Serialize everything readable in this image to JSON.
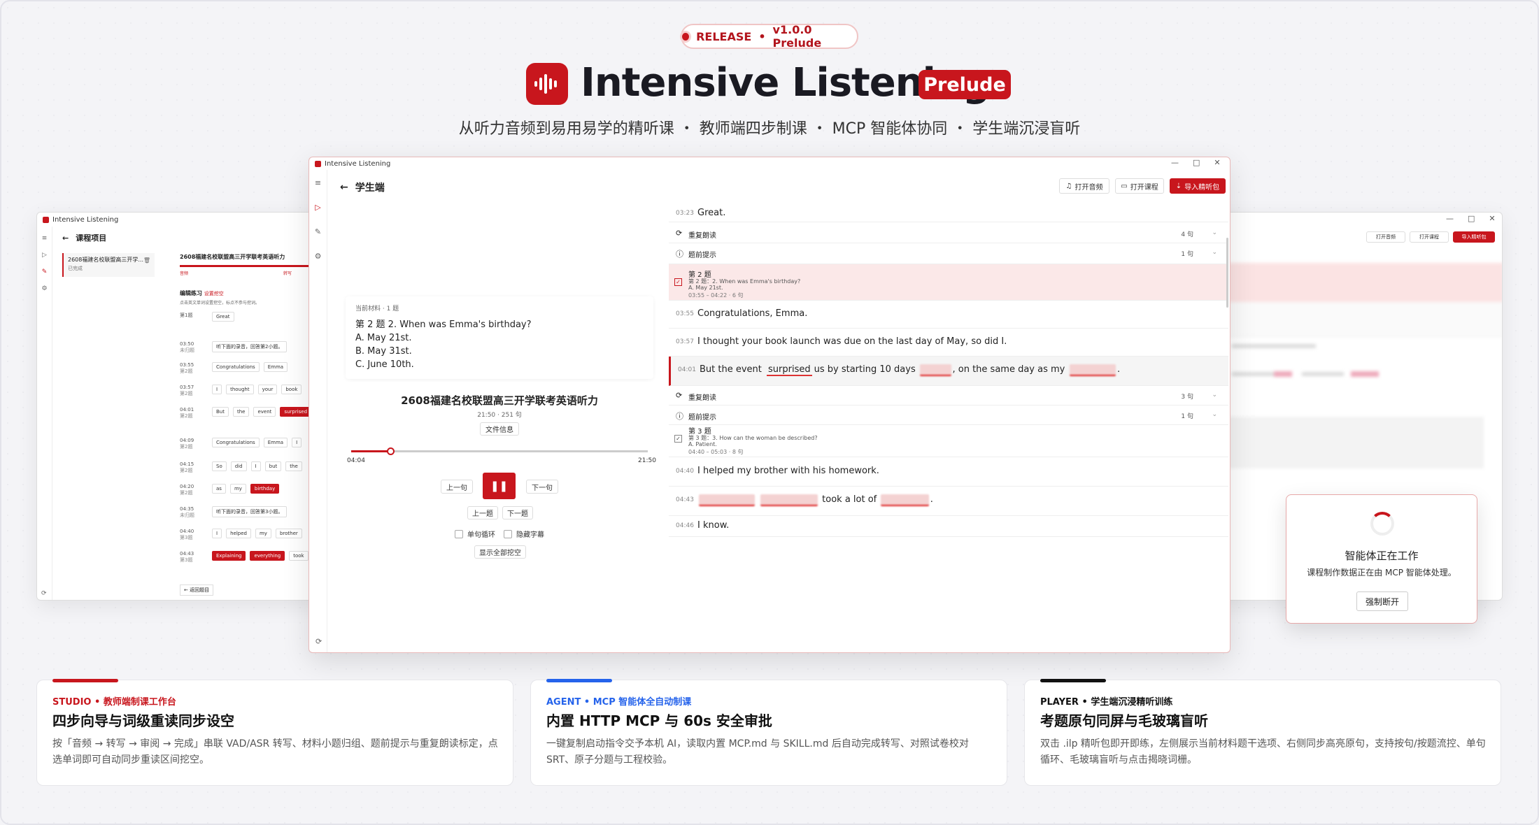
{
  "header": {
    "release_label": "RELEASE",
    "release_sep": "•",
    "release_version": "v1.0.0 Prelude",
    "title": "Intensive Listening",
    "badge": "Prelude",
    "subtitle": "从听力音频到易用易学的精听课 ・ 教师端四步制课 ・ MCP 智能体协同 ・ 学生端沉浸盲听"
  },
  "app_name": "Intensive Listening",
  "studio_window": {
    "page_title": "课程项目",
    "project_name": "2608福建名校联盟高三开学...",
    "project_status": "已完成",
    "material_title": "2608福建名校联盟高三开学联考英语听力",
    "tab_audio": "音频",
    "tab_transcribe": "转写",
    "edit_heading": "编辑练习",
    "edit_hint_red": "设置挖空",
    "edit_desc": "点击英文单词设置挖空，标点不参与挖词。",
    "back_to_list": "← 返回题目",
    "rows": [
      {
        "ts": "第1题",
        "sub": "",
        "chips": [
          "Great"
        ],
        "red": []
      },
      {
        "ts": "03:50",
        "sub": "未归题",
        "chips": [
          "听下面的录音，回答第2小题。"
        ],
        "red": []
      },
      {
        "ts": "03:55",
        "sub": "第2题",
        "chips": [
          "Congratulations",
          "Emma"
        ],
        "red": []
      },
      {
        "ts": "03:57",
        "sub": "第2题",
        "chips": [
          "I",
          "thought",
          "your",
          "book"
        ],
        "red": []
      },
      {
        "ts": "04:01",
        "sub": "第2题",
        "chips": [
          "But",
          "the",
          "event",
          "surprised"
        ],
        "red": [
          "surprised"
        ]
      },
      {
        "ts": "04:09",
        "sub": "第2题",
        "chips": [
          "Congratulations",
          "Emma",
          "I"
        ],
        "red": []
      },
      {
        "ts": "04:15",
        "sub": "第2题",
        "chips": [
          "So",
          "did",
          "I",
          "but",
          "the"
        ],
        "red": []
      },
      {
        "ts": "04:20",
        "sub": "第2题",
        "chips": [
          "as",
          "my",
          "birthday"
        ],
        "red": [
          "birthday"
        ]
      },
      {
        "ts": "04:35",
        "sub": "未归题",
        "chips": [
          "听下面的录音，回答第3小题。"
        ],
        "red": []
      },
      {
        "ts": "04:40",
        "sub": "第3题",
        "chips": [
          "I",
          "helped",
          "my",
          "brother"
        ],
        "red": []
      },
      {
        "ts": "04:43",
        "sub": "第3题",
        "chips": [
          "Explaining",
          "everything",
          "took"
        ],
        "red": [
          "Explaining",
          "everything"
        ]
      }
    ]
  },
  "player": {
    "page_title": "学生端",
    "btn_open_audio": "打开音频",
    "btn_open_course": "打开课程",
    "btn_import": "导入精听包",
    "question": {
      "meta": "当前材料 · 1 题",
      "stem": "第 2 题  2. When was Emma's birthday?",
      "options": [
        "A. May 21st.",
        "B. May 31st.",
        "C. June 10th."
      ]
    },
    "material_title": "2608福建名校联盟高三开学联考英语听力",
    "material_meta": "21:50 · 251 句",
    "file_info_btn": "文件信息",
    "progress": 0.133,
    "time_current": "04:04",
    "time_total": "21:50",
    "prev_sentence": "上一句",
    "next_sentence": "下一句",
    "play_icon": "pause-icon",
    "prev_question": "上一题",
    "next_question": "下一题",
    "loop_label": "单句循环",
    "hide_sub_label": "隐藏字幕",
    "reveal_all": "显示全部挖空",
    "transcript": [
      {
        "kind": "line",
        "ts": "03:23",
        "text": "Great."
      },
      {
        "kind": "sub",
        "icon": "repeat-icon",
        "label": "重复朗读",
        "count": "4 句"
      },
      {
        "kind": "sub",
        "icon": "info-icon",
        "label": "题前提示",
        "count": "1 句"
      },
      {
        "kind": "q",
        "title": "第 2 题",
        "detail": "第 2 题：2. When was Emma's birthday?",
        "answer": "A. May 21st.",
        "range": "03:55 – 04:22 · 6 句"
      },
      {
        "kind": "line",
        "ts": "03:55",
        "text": "Congratulations, Emma."
      },
      {
        "kind": "line",
        "ts": "03:57",
        "text": "I thought your book launch was due on the last day of May, so did I."
      },
      {
        "kind": "cloze",
        "ts": "04:01",
        "pre": "But the event",
        "ul": "surprised",
        "mid": "us by starting 10 days",
        "b1": "early",
        "mid2": ", on the same day as my",
        "b2": "birthday",
        "end": "."
      },
      {
        "kind": "sub",
        "icon": "repeat-icon",
        "label": "重复朗读",
        "count": "3 句"
      },
      {
        "kind": "sub",
        "icon": "info-icon",
        "label": "题前提示",
        "count": "1 句"
      },
      {
        "kind": "q",
        "title": "第 3 题",
        "detail": "第 3 题：3. How can the woman be described?",
        "answer": "A. Patient.",
        "range": "04:40 – 05:03 · 8 句"
      },
      {
        "kind": "line",
        "ts": "04:40",
        "text": "I helped my brother with his homework."
      },
      {
        "kind": "cloze2",
        "ts": "04:43",
        "b1": "Explaining",
        "b2": "everything",
        "mid": "took a lot of",
        "b3": "patience",
        "end": "."
      },
      {
        "kind": "line",
        "ts": "04:46",
        "text": "I know."
      }
    ]
  },
  "agent": {
    "heading": "智能体正在工作",
    "desc": "课程制作数据正在由 MCP 智能体处理。",
    "button": "强制断开"
  },
  "cards": [
    {
      "tag": "STUDIO",
      "tag_sep": "•",
      "tag_desc": "教师端制课工作台",
      "title": "四步向导与词级重读同步设空",
      "desc": "按「音频 → 转写 → 审阅 → 完成」串联 VAD/ASR 转写、材料小题归组、题前提示与重复朗读标定，点选单词即可自动同步重读区间挖空。",
      "color": "#c8161d"
    },
    {
      "tag": "AGENT",
      "tag_sep": "•",
      "tag_desc": "MCP 智能体全自动制课",
      "title": "内置 HTTP MCP 与 60s 安全审批",
      "desc": "一键复制启动指令交予本机 AI，读取内置 MCP.md 与 SKILL.md 后自动完成转写、对照试卷校对 SRT、原子分题与工程校验。",
      "color": "#2563eb"
    },
    {
      "tag": "PLAYER",
      "tag_sep": "•",
      "tag_desc": "学生端沉浸精听训练",
      "title": "考题原句同屏与毛玻璃盲听",
      "desc": "双击 .ilp 精听包即开即练，左侧展示当前材料题干选项、右侧同步高亮原句，支持按句/按题流控、单句循环、毛玻璃盲听与点击揭晓词栅。",
      "color": "#111111"
    }
  ]
}
